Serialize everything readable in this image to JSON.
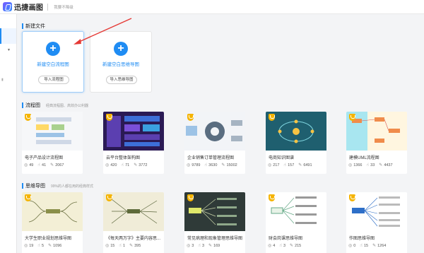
{
  "app": {
    "name": "迅捷画图",
    "subtitle": "我要不降级"
  },
  "sections": {
    "new_file": {
      "title": "新建文件"
    },
    "flowchart": {
      "title": "流程图",
      "desc": "经典流程图、高效办公利器"
    },
    "mindmap": {
      "title": "思维导图",
      "desc": "99%的人都在用的经典样式"
    }
  },
  "new_cards": [
    {
      "label": "新建空白流程图",
      "button": "导入流程图"
    },
    {
      "label": "新建空白思维导图",
      "button": "导入思维导图"
    }
  ],
  "flow_templates": [
    {
      "name": "电子产品设计流程图",
      "views": "49",
      "likes": "41",
      "uses": "2067",
      "theme": "light"
    },
    {
      "name": "云平台整体架构图",
      "views": "420",
      "likes": "71",
      "uses": "3772",
      "theme": "purple"
    },
    {
      "name": "企业销售订单管理流程图",
      "views": "9789",
      "likes": "3630",
      "uses": "15002",
      "theme": "gear"
    },
    {
      "name": "电商知识图谱",
      "views": "217",
      "likes": "157",
      "uses": "6491",
      "theme": "teal"
    },
    {
      "name": "建模UML流程图",
      "views": "1366",
      "likes": "33",
      "uses": "4437",
      "theme": "uml"
    }
  ],
  "mind_templates": [
    {
      "name": "大学生职业规划思维导图",
      "views": "19",
      "likes": "5",
      "uses": "1096",
      "theme": "beige"
    },
    {
      "name": "《每天两万字》主要内容思...",
      "views": "15",
      "likes": "1",
      "uses": "395",
      "theme": "beige2"
    },
    {
      "name": "常见病理和现象管理思维导图",
      "views": "3",
      "likes": "3",
      "uses": "169",
      "theme": "dark"
    },
    {
      "name": "财会岗课思维导图",
      "views": "4",
      "likes": "3",
      "uses": "215",
      "theme": "white"
    },
    {
      "name": "作图思维导图",
      "views": "0",
      "likes": "15",
      "uses": "1264",
      "theme": "white2"
    }
  ],
  "icons": {
    "views": "eye-icon",
    "likes": "thumb-up-icon",
    "uses": "edit-icon"
  },
  "colors": {
    "accent": "#1f8cf3",
    "crown": "#f5b400"
  }
}
